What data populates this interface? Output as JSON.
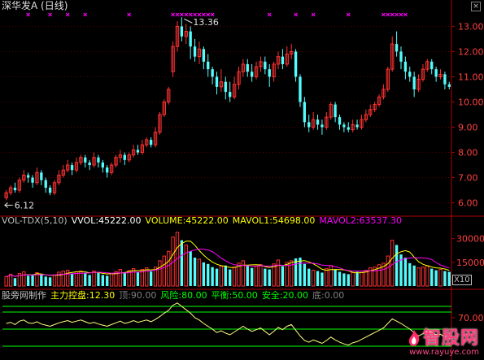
{
  "title": "深华发A (日线)",
  "close_icon": "close-x-icon",
  "colors": {
    "up": "#ff3232",
    "down": "#54fcfc",
    "axis": "#b00000",
    "text_label": "#c0c0c0",
    "vol": "#ffffff",
    "volume": "#ffff00",
    "mavol1": "#ffff00",
    "mavol2": "#ff00ff",
    "ind_line": "#ffff7f",
    "ind_level": "#00ff00",
    "marker": "#ff00ff",
    "tick": "#ff4040"
  },
  "price_panel": {
    "ylim": [
      5.6,
      13.4
    ],
    "ticks": [
      "13.00",
      "12.00",
      "11.00",
      "10.00",
      "9.00",
      "8.00",
      "7.00",
      "6.00"
    ],
    "tick_values": [
      13,
      12,
      11,
      10,
      9,
      8,
      7,
      6
    ],
    "high_label": "13.36",
    "low_label": "6.12"
  },
  "volume_panel": {
    "header": [
      {
        "text": "VOL-TDX(5,10)",
        "color": "#c0c0c0"
      },
      {
        "text": "VVOL:45222.00",
        "color": "#ffffff"
      },
      {
        "text": "VOLUME:45222.00",
        "color": "#ffff00"
      },
      {
        "text": "MAVOL1:54698.00",
        "color": "#ffff00"
      },
      {
        "text": "MAVOL2:63537.30",
        "color": "#ff00ff"
      }
    ],
    "ylim": [
      0,
      36000
    ],
    "ticks": [
      "30000",
      "15000"
    ],
    "tick_values": [
      30000,
      15000
    ],
    "unit": "X10"
  },
  "indicator_panel": {
    "header": [
      {
        "text": "股旁网制作",
        "color": "#c0c0c0"
      },
      {
        "text": "主力控盘:12.30",
        "color": "#ffff00"
      },
      {
        "text": "顶:90.00",
        "color": "#808080"
      },
      {
        "text": "风险:80.00",
        "color": "#00ff00"
      },
      {
        "text": "平衡:50.00",
        "color": "#00ff00"
      },
      {
        "text": "安全:20.00",
        "color": "#00ff00"
      },
      {
        "text": "底:0.00",
        "color": "#808080"
      }
    ],
    "ylim": [
      0,
      100
    ],
    "ticks": [
      "70.00"
    ],
    "tick_values": [
      70
    ],
    "levels": [
      90,
      80,
      50,
      20
    ]
  },
  "chart_data": {
    "type": "candlestick",
    "title": "深华发A (日线)",
    "price_high": 13.36,
    "price_low": 6.12,
    "candles": [
      [
        6.2,
        6.4,
        6.1,
        6.5
      ],
      [
        6.4,
        6.6,
        6.3,
        6.7
      ],
      [
        6.6,
        6.5,
        6.4,
        6.8
      ],
      [
        6.5,
        6.9,
        6.4,
        7.0
      ],
      [
        6.9,
        7.1,
        6.8,
        7.3
      ],
      [
        7.1,
        7.0,
        6.8,
        7.2
      ],
      [
        7.0,
        6.8,
        6.6,
        7.1
      ],
      [
        6.8,
        7.2,
        6.7,
        7.4
      ],
      [
        7.2,
        6.9,
        6.7,
        7.3
      ],
      [
        6.9,
        6.6,
        6.4,
        7.0
      ],
      [
        6.6,
        6.4,
        6.3,
        6.7
      ],
      [
        6.4,
        6.8,
        6.3,
        6.9
      ],
      [
        6.8,
        7.1,
        6.7,
        7.3
      ],
      [
        7.1,
        7.3,
        7.0,
        7.5
      ],
      [
        7.3,
        7.5,
        7.2,
        7.7
      ],
      [
        7.5,
        7.3,
        7.1,
        7.6
      ],
      [
        7.3,
        7.6,
        7.2,
        7.8
      ],
      [
        7.6,
        7.8,
        7.5,
        7.9
      ],
      [
        7.8,
        7.6,
        7.4,
        7.9
      ],
      [
        7.6,
        7.5,
        7.3,
        7.7
      ],
      [
        7.5,
        7.8,
        7.4,
        8.0
      ],
      [
        7.8,
        7.6,
        7.4,
        7.9
      ],
      [
        7.6,
        7.4,
        7.2,
        7.7
      ],
      [
        7.4,
        7.2,
        7.0,
        7.5
      ],
      [
        7.2,
        7.5,
        7.1,
        7.6
      ],
      [
        7.5,
        7.8,
        7.4,
        7.9
      ],
      [
        7.8,
        7.9,
        7.6,
        8.1
      ],
      [
        7.9,
        7.7,
        7.5,
        8.0
      ],
      [
        7.7,
        7.9,
        7.6,
        8.0
      ],
      [
        7.9,
        8.1,
        7.8,
        8.3
      ],
      [
        8.1,
        8.0,
        7.9,
        8.3
      ],
      [
        8.0,
        8.3,
        7.9,
        8.5
      ],
      [
        8.3,
        8.5,
        8.2,
        8.6
      ],
      [
        8.5,
        8.3,
        8.2,
        8.6
      ],
      [
        8.3,
        8.8,
        8.2,
        9.0
      ],
      [
        8.8,
        9.5,
        8.7,
        9.6
      ],
      [
        9.5,
        10.0,
        9.4,
        10.1
      ],
      [
        10.0,
        10.5,
        9.9,
        10.6
      ],
      [
        11.2,
        12.2,
        11.0,
        12.4
      ],
      [
        12.2,
        13.0,
        12.0,
        13.2
      ],
      [
        13.0,
        12.6,
        12.4,
        13.36
      ],
      [
        12.6,
        12.8,
        12.3,
        13.1
      ],
      [
        12.8,
        12.2,
        11.7,
        13.0
      ],
      [
        12.2,
        11.8,
        11.6,
        12.5
      ],
      [
        11.8,
        12.1,
        11.5,
        12.4
      ],
      [
        12.1,
        11.6,
        11.3,
        12.2
      ],
      [
        11.6,
        11.3,
        11.0,
        11.9
      ],
      [
        11.3,
        11.0,
        10.7,
        11.4
      ],
      [
        11.0,
        10.6,
        10.3,
        11.2
      ],
      [
        10.6,
        10.8,
        10.4,
        11.3
      ],
      [
        10.8,
        10.4,
        10.1,
        11.0
      ],
      [
        10.4,
        10.2,
        10.0,
        10.8
      ],
      [
        10.2,
        10.7,
        10.1,
        11.0
      ],
      [
        10.7,
        11.2,
        10.5,
        11.4
      ],
      [
        11.2,
        11.5,
        11.0,
        11.7
      ],
      [
        11.5,
        11.2,
        11.0,
        11.7
      ],
      [
        11.2,
        11.0,
        10.8,
        11.5
      ],
      [
        11.0,
        11.4,
        10.9,
        11.6
      ],
      [
        11.4,
        11.6,
        11.2,
        11.8
      ],
      [
        11.6,
        11.3,
        11.1,
        11.8
      ],
      [
        11.3,
        11.0,
        10.6,
        11.5
      ],
      [
        11.0,
        11.5,
        10.8,
        11.6
      ],
      [
        11.5,
        11.8,
        11.3,
        12.0
      ],
      [
        11.8,
        11.5,
        11.3,
        12.1
      ],
      [
        11.5,
        11.9,
        11.4,
        12.2
      ],
      [
        11.9,
        12.0,
        11.7,
        12.3
      ],
      [
        12.0,
        11.0,
        10.8,
        12.1
      ],
      [
        11.0,
        10.0,
        9.8,
        11.1
      ],
      [
        10.0,
        9.2,
        9.0,
        10.2
      ],
      [
        9.2,
        9.0,
        8.8,
        9.5
      ],
      [
        9.0,
        9.3,
        8.9,
        9.6
      ],
      [
        9.3,
        9.1,
        8.9,
        9.5
      ],
      [
        9.1,
        9.0,
        8.7,
        9.3
      ],
      [
        9.0,
        9.4,
        8.9,
        9.6
      ],
      [
        9.4,
        9.9,
        9.3,
        10.0
      ],
      [
        9.9,
        9.4,
        9.2,
        10.0
      ],
      [
        9.4,
        9.1,
        8.9,
        9.5
      ],
      [
        9.1,
        9.0,
        8.8,
        9.2
      ],
      [
        9.0,
        8.9,
        8.8,
        9.2
      ],
      [
        8.9,
        9.1,
        8.8,
        9.3
      ],
      [
        9.1,
        9.0,
        8.9,
        9.3
      ],
      [
        9.0,
        9.3,
        8.9,
        9.5
      ],
      [
        9.3,
        9.5,
        9.2,
        9.7
      ],
      [
        9.5,
        9.7,
        9.4,
        9.9
      ],
      [
        9.7,
        9.9,
        9.6,
        10.0
      ],
      [
        9.9,
        10.2,
        9.8,
        10.3
      ],
      [
        10.2,
        10.5,
        10.1,
        10.7
      ],
      [
        10.5,
        11.3,
        10.4,
        11.4
      ],
      [
        11.3,
        12.3,
        11.2,
        12.6
      ],
      [
        12.3,
        12.0,
        11.8,
        12.8
      ],
      [
        12.0,
        11.6,
        11.3,
        12.2
      ],
      [
        11.6,
        11.2,
        10.9,
        11.8
      ],
      [
        11.2,
        11.0,
        10.8,
        11.4
      ],
      [
        11.0,
        10.5,
        10.2,
        11.2
      ],
      [
        10.5,
        10.9,
        10.4,
        11.1
      ],
      [
        10.9,
        11.3,
        10.8,
        11.5
      ],
      [
        11.3,
        11.6,
        11.2,
        11.7
      ],
      [
        11.6,
        11.3,
        11.1,
        11.7
      ],
      [
        11.3,
        11.0,
        10.8,
        11.4
      ],
      [
        11.0,
        11.1,
        10.9,
        11.3
      ],
      [
        11.1,
        10.7,
        10.5,
        11.2
      ],
      [
        10.7,
        10.6,
        10.5,
        10.8
      ]
    ],
    "volume": [
      6000,
      7500,
      5000,
      8000,
      9000,
      6500,
      7000,
      8500,
      7200,
      6000,
      5500,
      7000,
      8800,
      9500,
      10000,
      8000,
      9000,
      9500,
      8500,
      7000,
      9500,
      8200,
      7000,
      6500,
      8000,
      9200,
      10500,
      8600,
      9800,
      11000,
      9000,
      10500,
      11500,
      9200,
      12000,
      16000,
      19000,
      22000,
      31000,
      34000,
      29000,
      26000,
      22000,
      18000,
      17000,
      15000,
      14000,
      12000,
      11000,
      12500,
      13000,
      10500,
      12000,
      14500,
      16000,
      13000,
      11500,
      12500,
      13500,
      11000,
      10500,
      14000,
      16500,
      12500,
      15000,
      16000,
      17500,
      18000,
      14000,
      11000,
      10000,
      9500,
      8500,
      11000,
      13000,
      10500,
      9000,
      8000,
      7500,
      8500,
      9000,
      9500,
      10000,
      11500,
      12000,
      13500,
      14500,
      19000,
      29000,
      26000,
      20000,
      18000,
      14500,
      13000,
      11500,
      12000,
      13000,
      11000,
      10000,
      10500,
      9500,
      9000
    ],
    "controlling": [
      60,
      62,
      58,
      64,
      66,
      61,
      60,
      63,
      59,
      57,
      55,
      58,
      61,
      63,
      65,
      62,
      64,
      66,
      63,
      60,
      62,
      59,
      57,
      55,
      58,
      61,
      64,
      60,
      62,
      65,
      62,
      64,
      66,
      63,
      67,
      72,
      78,
      83,
      92,
      96,
      90,
      84,
      78,
      70,
      66,
      60,
      55,
      50,
      44,
      47,
      43,
      40,
      45,
      50,
      55,
      50,
      46,
      49,
      52,
      46,
      40,
      46,
      53,
      49,
      55,
      58,
      48,
      38,
      30,
      27,
      31,
      28,
      25,
      30,
      36,
      31,
      27,
      24,
      22,
      26,
      28,
      32,
      36,
      40,
      44,
      48,
      52,
      60,
      68,
      64,
      60,
      55,
      50,
      44,
      38,
      42,
      47,
      44,
      40,
      41,
      36,
      34
    ]
  }
}
